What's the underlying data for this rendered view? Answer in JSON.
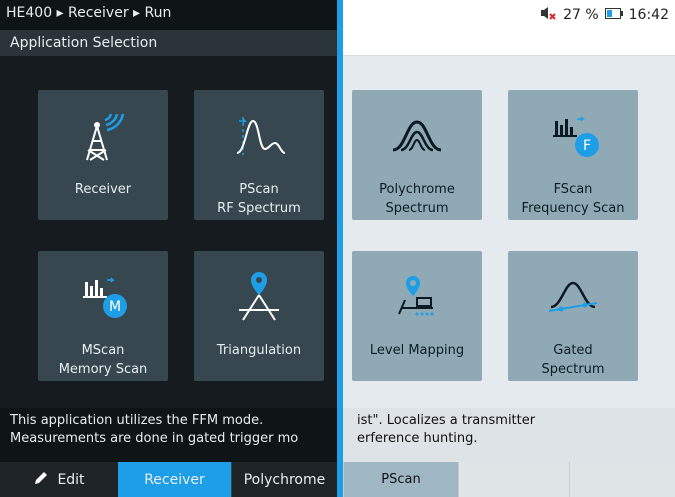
{
  "status": {
    "breadcrumb": "HE400 ▸ Receiver ▸ Run",
    "battery": "27 %",
    "time": "16:42"
  },
  "header": {
    "title": "Application Selection"
  },
  "light_tiles": [
    {
      "label_line1": "Polychrome",
      "label_line2": "Spectrum"
    },
    {
      "label_line1": "FScan",
      "label_line2": "Frequency Scan"
    },
    {
      "label_line1": "Level Mapping",
      "label_line2": ""
    },
    {
      "label_line1": "Gated",
      "label_line2": "Spectrum"
    }
  ],
  "dark_tiles": [
    {
      "label_line1": "Receiver",
      "label_line2": ""
    },
    {
      "label_line1": "PScan",
      "label_line2": "RF Spectrum"
    },
    {
      "label_line1": "MScan",
      "label_line2": "Memory Scan"
    },
    {
      "label_line1": "Triangulation",
      "label_line2": ""
    }
  ],
  "light_description": {
    "line1": "ist\". Localizes a transmitter",
    "line2": "erference hunting."
  },
  "dark_description": {
    "line1": "This application utilizes the FFM mode.",
    "line2": "Measurements are done in gated trigger mo"
  },
  "light_footer": {
    "tab_pscan": "PScan"
  },
  "dark_footer": {
    "edit": "Edit",
    "receiver": "Receiver",
    "polychrome": "Polychrome"
  },
  "colors": {
    "accent": "#1e9ee6",
    "tile_light": "#8fa9b5",
    "tile_dark": "#36474f"
  },
  "icons": {
    "fscan_badge": "F",
    "mscan_badge": "M"
  }
}
